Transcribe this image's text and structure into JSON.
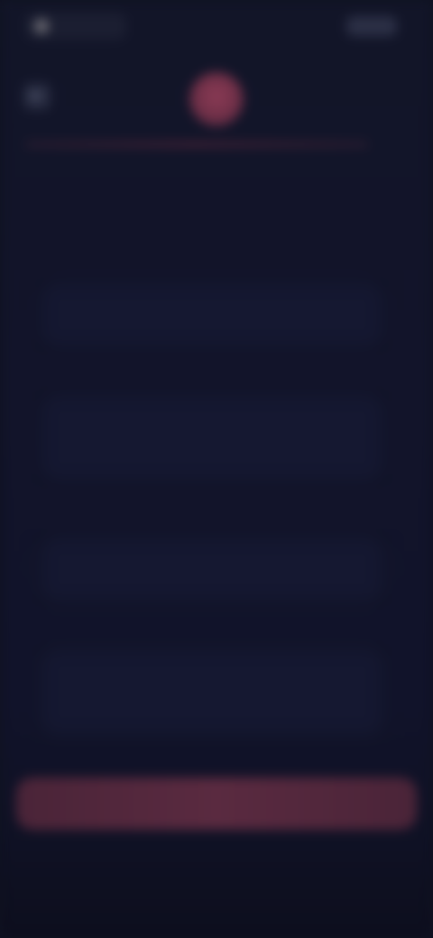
{
  "status_bar": {
    "left_text": "",
    "right_text": ""
  },
  "header": {
    "back_icon": "←",
    "headline": ""
  },
  "cards": [
    {
      "title": "",
      "body": ""
    },
    {
      "title": "",
      "body": ""
    },
    {
      "title": "",
      "body": ""
    },
    {
      "title": "",
      "body": ""
    }
  ],
  "cta": {
    "label": ""
  },
  "colors": {
    "background": "#12142a",
    "accent": "#6a2a3f",
    "card": "#151831"
  }
}
